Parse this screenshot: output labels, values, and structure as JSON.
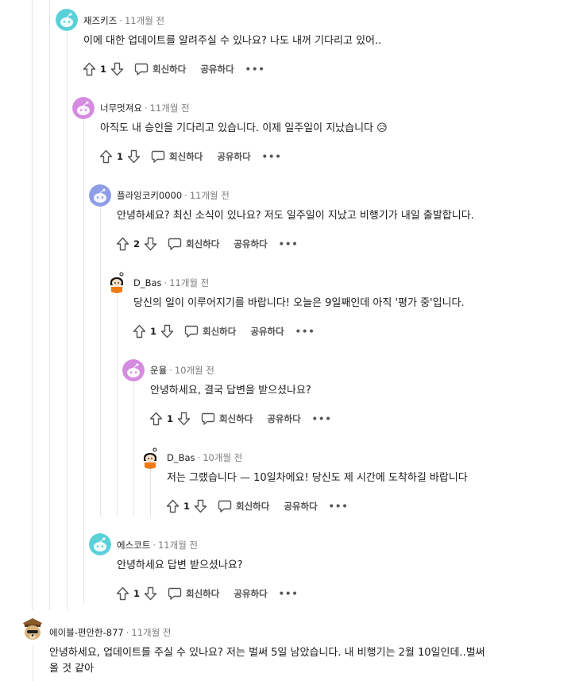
{
  "comments": [
    {
      "author": "재즈키즈",
      "time": "11개월 전",
      "text": "이에 대한 업데이트를 알려주실 수 있나요? 나도 내꺼 기다리고 있어..",
      "votes": "1",
      "reply": "회신하다",
      "share": "공유하다",
      "avatar_color": "#5ad1d8"
    },
    {
      "author": "너무멋져요",
      "time": "11개월 전",
      "text": "아직도 내 승인을 기다리고 있습니다. 이제 일주일이 지났습니다 😥",
      "votes": "1",
      "reply": "회신하다",
      "share": "공유하다",
      "avatar_color": "#d58be0"
    },
    {
      "author": "플라잉코키0000",
      "time": "11개월 전",
      "text": "안녕하세요? 최신 소식이 있나요? 저도 일주일이 지났고 비행기가 내일 출발합니다.",
      "votes": "2",
      "reply": "회신하다",
      "share": "공유하다",
      "avatar_color": "#8e9de8"
    },
    {
      "author": "D_Bas",
      "time": "11개월 전",
      "text": "당신의 일이 이루어지기를 바랍니다! 오늘은 9일째인데 아직 '평가 중'입니다.",
      "votes": "1",
      "reply": "회신하다",
      "share": "공유하다",
      "avatar_color": "#ffffff"
    },
    {
      "author": "운율",
      "time": "10개월 전",
      "text": "안녕하세요, 결국 답변을 받으셨나요?",
      "votes": "1",
      "reply": "회신하다",
      "share": "공유하다",
      "avatar_color": "#d58be0"
    },
    {
      "author": "D_Bas",
      "time": "10개월 전",
      "text": "저는 그랬습니다 — 10일차에요! 당신도 제 시간에 도착하길 바랍니다",
      "votes": "1",
      "reply": "회신하다",
      "share": "공유하다",
      "avatar_color": "#ffffff"
    },
    {
      "author": "에스코트",
      "time": "11개월 전",
      "text": "안녕하세요 답변 받으셨나요?",
      "votes": "1",
      "reply": "회신하다",
      "share": "공유하다",
      "avatar_color": "#5ad1d8"
    },
    {
      "author": "에이블-편안한-877",
      "time": "11개월 전",
      "text": "안녕하세요, 업데이트를 주실 수 있나요? 저는 벌써 5일 남았습니다. 내 비행기는 2월 10일인데..벌써",
      "text2": "올 것 같아",
      "avatar_color": "#ffffff"
    }
  ],
  "meta": {
    "separator": "·"
  },
  "icons": {
    "upvote": "upvote-arrow-icon",
    "downvote": "downvote-arrow-icon",
    "reply": "speech-bubble-icon",
    "more": "more-dots-icon"
  }
}
